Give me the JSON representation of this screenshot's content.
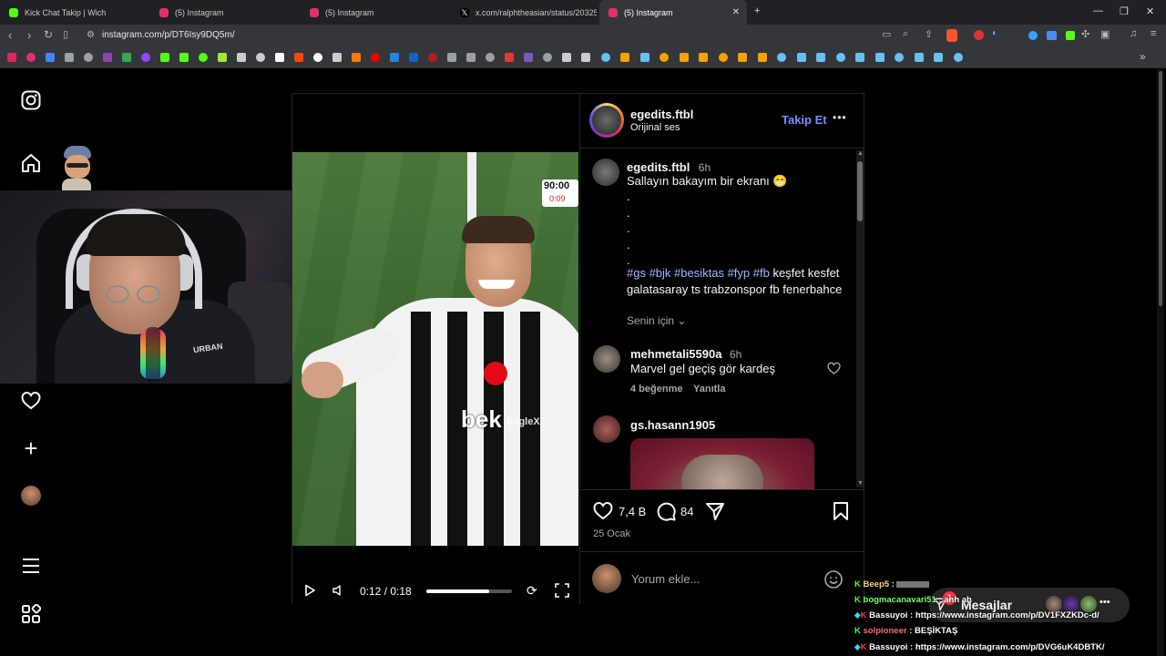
{
  "tabs": [
    {
      "title": "Kick Chat Takip | Wich",
      "color": "#53fc18",
      "active": false
    },
    {
      "title": "(5) Instagram",
      "color": "#e1306c",
      "active": false
    },
    {
      "title": "(5) Instagram",
      "color": "#e1306c",
      "active": false
    },
    {
      "title": "x.com/ralphtheasian/status/2032538",
      "color": "#ffffff",
      "active": false
    },
    {
      "title": "(5) Instagram",
      "color": "#e1306c",
      "active": true
    }
  ],
  "url": "instagram.com/p/DT6Isy9DQ5m/",
  "post": {
    "author": "egedits.ftbl",
    "audio": "Orijinal ses",
    "follow_label": "Takip Et",
    "more_label": "•••",
    "caption_author": "egedits.ftbl",
    "caption_time": "6h",
    "caption_text": "Sallayın bakayım bir ekranı 😁",
    "caption_dots": [
      ".",
      ".",
      ".",
      ".",
      "."
    ],
    "hashtags": "#gs #bjk #besiktas #fyp #fb",
    "caption_tail": " keşfet kesfet galatasaray ts trabzonspor fb fenerbahce",
    "for_you": "Senin için",
    "likes": "7,4 B",
    "comments_count": "84",
    "date": "25 Ocak",
    "comment_placeholder": "Yorum ekle..."
  },
  "comments": [
    {
      "user": "mehmetali5590a",
      "time": "6h",
      "text": "Marvel gel geçiş gör kardeş",
      "likes": "4 beğenme",
      "reply": "Yanıtla"
    },
    {
      "user": "gs.hasann1905",
      "time": "",
      "text": "",
      "likes": "",
      "reply": ""
    }
  ],
  "video": {
    "time": "0:12 / 0:18",
    "progress": 0.73,
    "scoreboard_main": "90:00",
    "scoreboard_extra": "0:09",
    "watermark": "EagleX7",
    "shirt": "bek"
  },
  "webcam": {
    "shirt_text": "URBAN"
  },
  "messages_label": "Mesajlar",
  "notification_dot": "1",
  "chat": [
    {
      "user": "Beep5",
      "text": "",
      "color": "#ffd27f"
    },
    {
      "user": "bogmacanavari51",
      "text": "ahh ah",
      "color": "#7CFF6B"
    },
    {
      "user": "Bassuyoi",
      "text": "https://www.instagram.com/p/DV1FXZKDc-d/",
      "color": "#ffffff"
    },
    {
      "user": "solpioneer",
      "text": "BEŞİKTAŞ",
      "color": "#ff6b6b"
    },
    {
      "user": "Bassuyoi",
      "text": "https://www.instagram.com/p/DVG6uK4DBTK/",
      "color": "#ffffff"
    }
  ],
  "colors": {
    "accent_blue": "#7d8bff",
    "instagram_bg": "#000000",
    "link": "#a3b8ff"
  }
}
